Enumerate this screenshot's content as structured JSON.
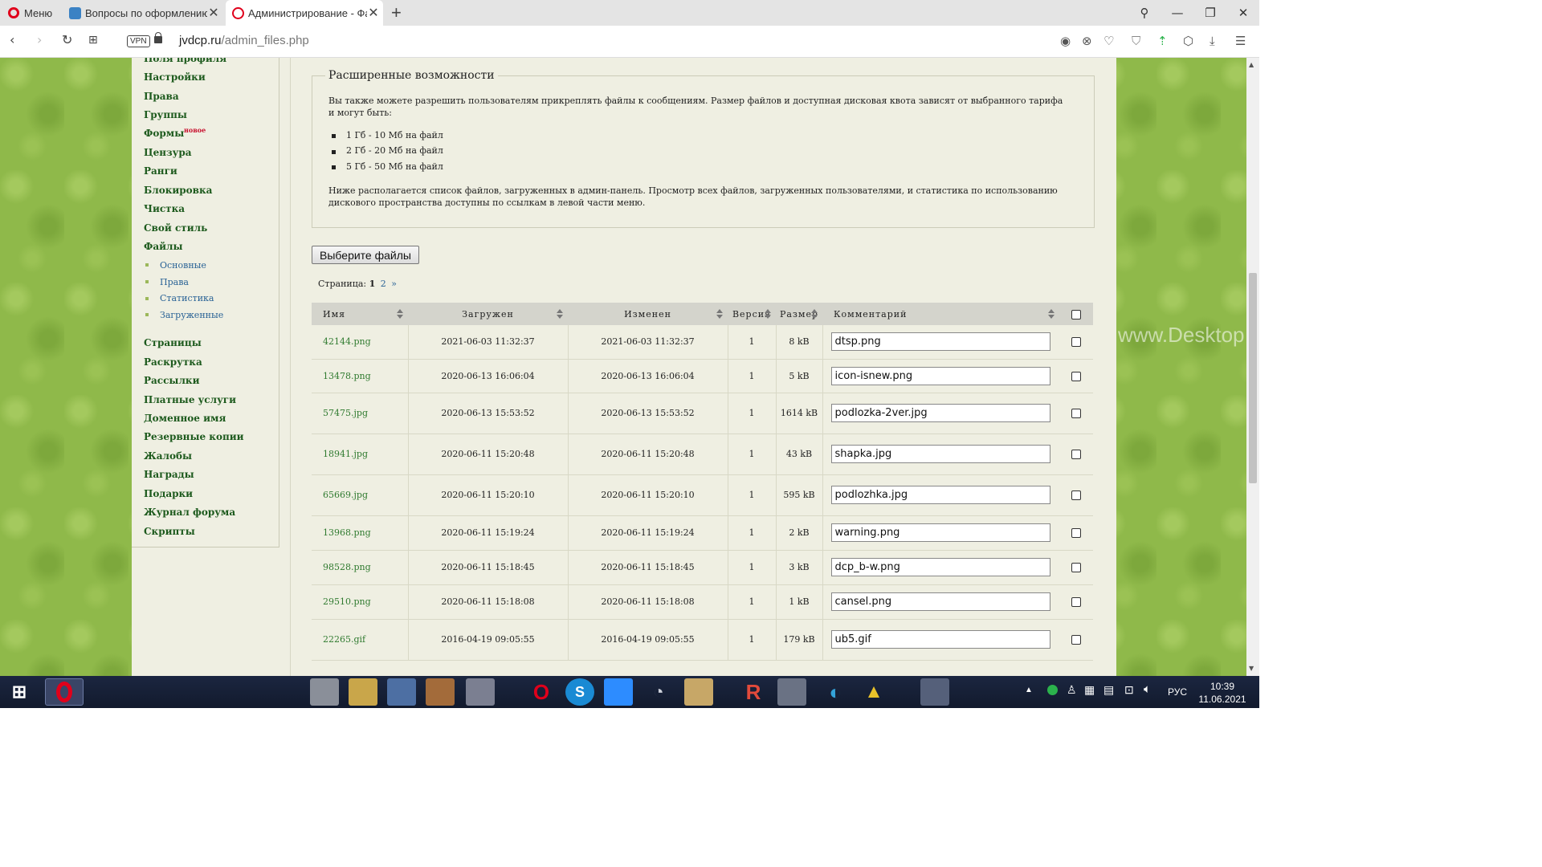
{
  "browser": {
    "menu_label": "Меню",
    "tabs": [
      {
        "title": "Вопросы по оформлению",
        "icon": "forum-favicon-icon"
      },
      {
        "title": "Администрирование - Файлы",
        "icon": "jvdcp-favicon-icon"
      }
    ],
    "vpn_label": "VPN",
    "url_host": "jvdcp.ru",
    "url_path": "/admin_files.php"
  },
  "sidebar": {
    "top_items": [
      "Поля профиля",
      "Настройки",
      "Права",
      "Группы",
      "Формы",
      "Цензура",
      "Ранги",
      "Блокировка",
      "Чистка",
      "Свой стиль",
      "Файлы"
    ],
    "new_badge": "новое",
    "files_subitems": [
      "Основные",
      "Права",
      "Статистика",
      "Загруженные"
    ],
    "bottom_items": [
      "Страницы",
      "Раскрутка",
      "Рассылки",
      "Платные услуги",
      "Доменное имя",
      "Резервные копии",
      "Жалобы",
      "Награды",
      "Подарки",
      "Журнал форума",
      "Скрипты"
    ]
  },
  "extended": {
    "legend": "Расширенные возможности",
    "intro": "Вы также можете разрешить пользователям прикреплять файлы к сообщениям. Размер файлов и доступная дисковая квота зависят от выбранного тарифа и могут быть:",
    "plans": [
      "1 Гб - 10 Мб на файл",
      "2 Гб - 20 Мб на файл",
      "5 Гб - 50 Мб на файл"
    ],
    "outro": "Ниже располагается список файлов, загруженных в админ-панель. Просмотр всех файлов, загруженных пользователями, и статистика по использованию дискового пространства доступны по ссылкам в левой части меню."
  },
  "upload_button": "Выберите файлы",
  "pager": {
    "label": "Страница:",
    "current": "1",
    "pages": [
      "2"
    ],
    "next": "»"
  },
  "table": {
    "headers": {
      "name": "Имя",
      "uploaded": "Загружен",
      "modified": "Изменен",
      "version": "Версия",
      "size": "Размер",
      "comment": "Комментарий"
    },
    "rows": [
      {
        "name": "42144.png",
        "uploaded": "2021-06-03 11:32:37",
        "modified": "2021-06-03 11:32:37",
        "version": "1",
        "size": "8 kB",
        "comment": "dtsp.png"
      },
      {
        "name": "13478.png",
        "uploaded": "2020-06-13 16:06:04",
        "modified": "2020-06-13 16:06:04",
        "version": "1",
        "size": "5 kB",
        "comment": "icon-isnew.png"
      },
      {
        "name": "57475.jpg",
        "uploaded": "2020-06-13 15:53:52",
        "modified": "2020-06-13 15:53:52",
        "version": "1",
        "size": "1614 kB",
        "comment": "podlozka-2ver.jpg"
      },
      {
        "name": "18941.jpg",
        "uploaded": "2020-06-11 15:20:48",
        "modified": "2020-06-11 15:20:48",
        "version": "1",
        "size": "43 kB",
        "comment": "shapka.jpg"
      },
      {
        "name": "65669.jpg",
        "uploaded": "2020-06-11 15:20:10",
        "modified": "2020-06-11 15:20:10",
        "version": "1",
        "size": "595 kB",
        "comment": "podlozhka.jpg"
      },
      {
        "name": "13968.png",
        "uploaded": "2020-06-11 15:19:24",
        "modified": "2020-06-11 15:19:24",
        "version": "1",
        "size": "2 kB",
        "comment": "warning.png"
      },
      {
        "name": "98528.png",
        "uploaded": "2020-06-11 15:18:45",
        "modified": "2020-06-11 15:18:45",
        "version": "1",
        "size": "3 kB",
        "comment": "dcp_b-w.png"
      },
      {
        "name": "29510.png",
        "uploaded": "2020-06-11 15:18:08",
        "modified": "2020-06-11 15:18:08",
        "version": "1",
        "size": "1 kB",
        "comment": "cansel.png"
      },
      {
        "name": "22265.gif",
        "uploaded": "2016-04-19 09:05:55",
        "modified": "2016-04-19 09:05:55",
        "version": "1",
        "size": "179 kB",
        "comment": "ub5.gif"
      }
    ]
  },
  "watermark": "www.Desktop",
  "taskbar": {
    "tray_lang": "РУС",
    "time": "10:39",
    "date": "11.06.2021"
  }
}
